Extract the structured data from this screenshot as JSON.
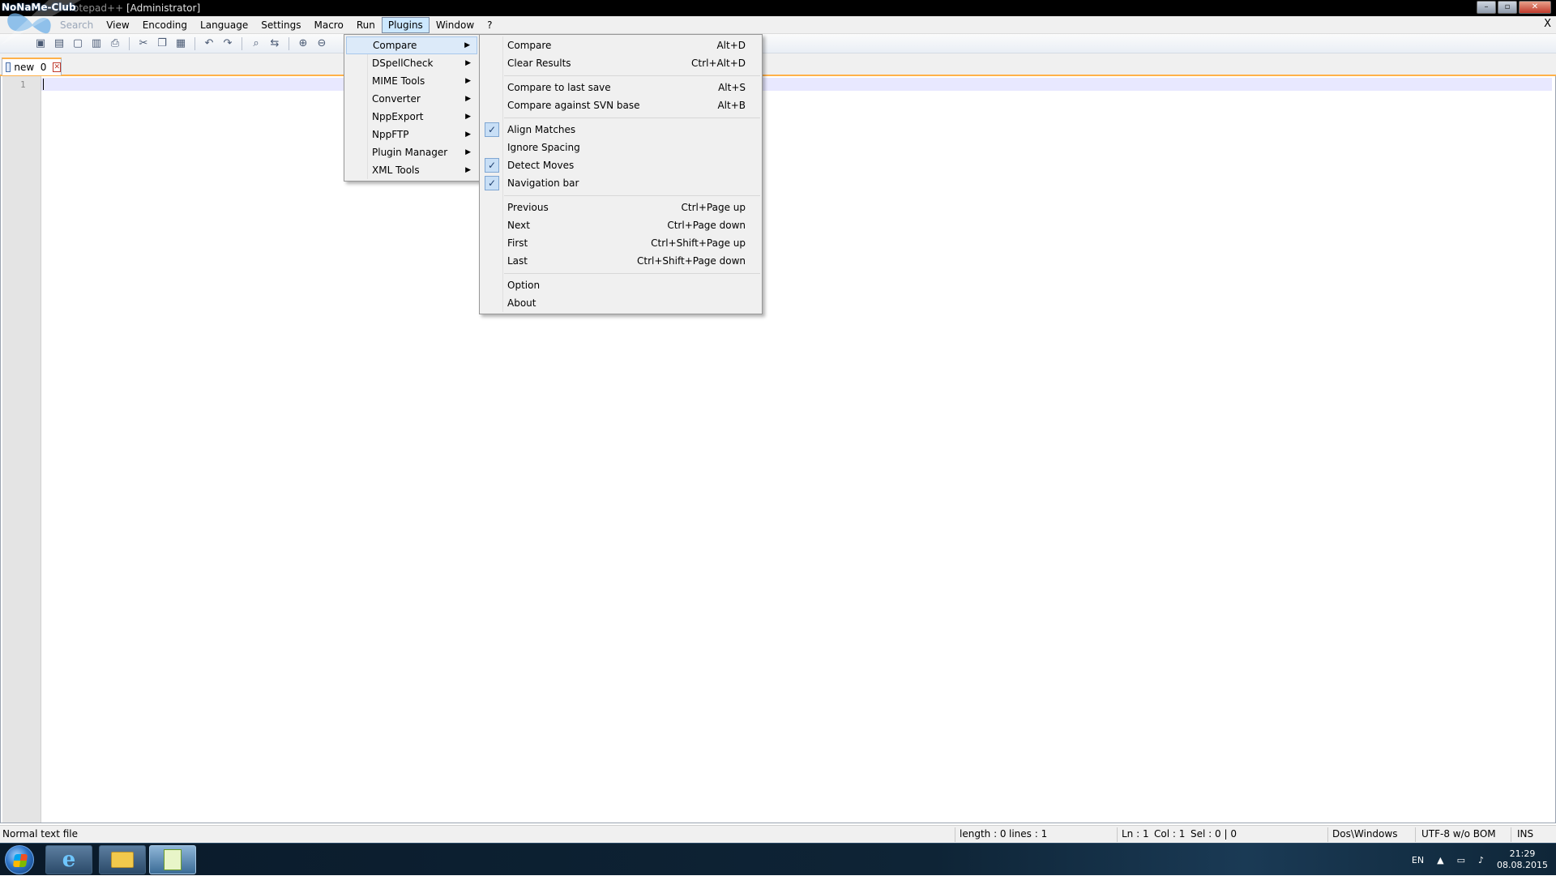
{
  "titlebar": {
    "logo_text": "NoNaMe-Club",
    "title_faded": "otepad++",
    "title_suffix": "[Administrator]",
    "minimize": "–",
    "maximize": "▫",
    "close": "✕"
  },
  "menubar": {
    "items": [
      "Search",
      "View",
      "Encoding",
      "Language",
      "Settings",
      "Macro",
      "Run",
      "Plugins",
      "Window",
      "?"
    ],
    "close_label": "X"
  },
  "tab": {
    "label": "new  0",
    "close": "✕"
  },
  "editor": {
    "line_number": "1"
  },
  "plugins_menu": {
    "items": [
      {
        "label": "Compare",
        "arrow": "▶"
      },
      {
        "label": "DSpellCheck",
        "arrow": "▶"
      },
      {
        "label": "MIME Tools",
        "arrow": "▶"
      },
      {
        "label": "Converter",
        "arrow": "▶"
      },
      {
        "label": "NppExport",
        "arrow": "▶"
      },
      {
        "label": "NppFTP",
        "arrow": "▶"
      },
      {
        "label": "Plugin Manager",
        "arrow": "▶"
      },
      {
        "label": "XML Tools",
        "arrow": "▶"
      }
    ]
  },
  "compare_menu": {
    "items": [
      {
        "label": "Compare",
        "accel": "Alt+D"
      },
      {
        "label": "Clear Results",
        "accel": "Ctrl+Alt+D"
      },
      {
        "label": "Compare to last save",
        "accel": "Alt+S"
      },
      {
        "label": "Compare against SVN base",
        "accel": "Alt+B"
      },
      {
        "label": "Align Matches",
        "check": "✓"
      },
      {
        "label": "Ignore Spacing"
      },
      {
        "label": "Detect Moves",
        "check": "✓"
      },
      {
        "label": "Navigation bar",
        "check": "✓"
      },
      {
        "label": "Previous",
        "accel": "Ctrl+Page up"
      },
      {
        "label": "Next",
        "accel": "Ctrl+Page down"
      },
      {
        "label": "First",
        "accel": "Ctrl+Shift+Page up"
      },
      {
        "label": "Last",
        "accel": "Ctrl+Shift+Page down"
      },
      {
        "label": "Option"
      },
      {
        "label": "About"
      }
    ]
  },
  "statusbar": {
    "file_type": "Normal text file",
    "length": "length : 0",
    "lines": "lines : 1",
    "ln": "Ln : 1",
    "col": "Col : 1",
    "sel": "Sel : 0 | 0",
    "eol": "Dos\\Windows",
    "encoding": "UTF-8 w/o BOM",
    "mode": "INS"
  },
  "taskbar": {
    "lang": "EN",
    "time": "21:29",
    "date": "08.08.2015",
    "ie_glyph": "e"
  }
}
